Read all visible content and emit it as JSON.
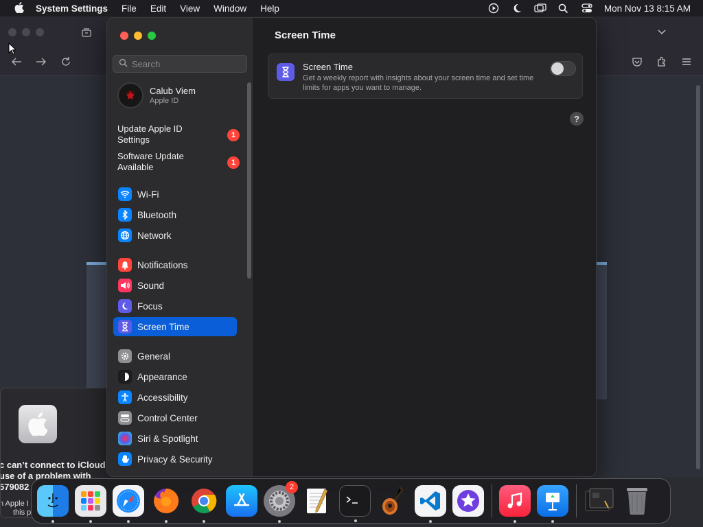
{
  "menubar": {
    "app_name": "System Settings",
    "menus": [
      "File",
      "Edit",
      "View",
      "Window",
      "Help"
    ],
    "clock": "Mon Nov 13  8:15 AM"
  },
  "icloud_dialog": {
    "message_lines": [
      "c can’t connect to iCloud",
      "use of a problem with",
      "579082"
    ],
    "sub_lines": [
      "n Apple I",
      "this p"
    ]
  },
  "settings": {
    "search_placeholder": "Search",
    "account": {
      "name": "Calub Viem",
      "subtitle": "Apple ID"
    },
    "notices": [
      {
        "label": "Update Apple ID Settings",
        "badge": "1"
      },
      {
        "label": "Software Update Available",
        "badge": "1"
      }
    ],
    "nav_items": [
      {
        "label": "Wi-Fi",
        "icon": "wifi-icon",
        "color": "#0a84ff"
      },
      {
        "label": "Bluetooth",
        "icon": "bluetooth-icon",
        "color": "#0a84ff"
      },
      {
        "label": "Network",
        "icon": "globe-icon",
        "color": "#0a84ff"
      },
      {
        "label": "Notifications",
        "icon": "bell-icon",
        "color": "#ff453a"
      },
      {
        "label": "Sound",
        "icon": "speaker-icon",
        "color": "#ff375f"
      },
      {
        "label": "Focus",
        "icon": "moon-icon",
        "color": "#5e5ce6"
      },
      {
        "label": "Screen Time",
        "icon": "hourglass-icon",
        "color": "#5e5ce6",
        "selected": true
      },
      {
        "label": "General",
        "icon": "gear-icon",
        "color": "#8e8e93"
      },
      {
        "label": "Appearance",
        "icon": "appearance-icon",
        "color": "#1c1c1e"
      },
      {
        "label": "Accessibility",
        "icon": "accessibility-icon",
        "color": "#0a84ff"
      },
      {
        "label": "Control Center",
        "icon": "control-center-icon",
        "color": "#8e8e93"
      },
      {
        "label": "Siri & Spotlight",
        "icon": "siri-icon",
        "color": "#2c2c2e"
      },
      {
        "label": "Privacy & Security",
        "icon": "hand-icon",
        "color": "#0a84ff"
      }
    ],
    "main": {
      "title": "Screen Time",
      "card": {
        "heading": "Screen Time",
        "description": "Get a weekly report with insights about your screen time and set time limits for apps you want to manage.",
        "toggle_on": false
      },
      "help": "?"
    }
  },
  "dock": {
    "apps": [
      {
        "name": "Finder",
        "icon": "finder-icon",
        "running": true
      },
      {
        "name": "Launchpad",
        "icon": "launchpad-icon",
        "running": true
      },
      {
        "name": "Safari",
        "icon": "safari-icon",
        "running": true
      },
      {
        "name": "Firefox",
        "icon": "firefox-icon",
        "running": true
      },
      {
        "name": "Chrome",
        "icon": "chrome-icon",
        "running": true
      },
      {
        "name": "App Store",
        "icon": "app-store-icon",
        "running": false
      },
      {
        "name": "System Settings",
        "icon": "system-settings-icon",
        "running": true,
        "badge": "2"
      },
      {
        "name": "TextEdit",
        "icon": "textedit-icon",
        "running": false
      },
      {
        "name": "Terminal",
        "icon": "terminal-icon",
        "running": true
      },
      {
        "name": "GarageBand",
        "icon": "garageband-icon",
        "running": false
      },
      {
        "name": "Visual Studio Code",
        "icon": "vscode-icon",
        "running": true
      },
      {
        "name": "iMovie",
        "icon": "imovie-icon",
        "running": false
      },
      {
        "name": "Music",
        "icon": "music-icon",
        "running": true
      },
      {
        "name": "Keynote",
        "icon": "keynote-icon",
        "running": true
      },
      {
        "name": "Downloads",
        "icon": "downloads-stack-icon",
        "running": false
      },
      {
        "name": "Trash",
        "icon": "trash-icon",
        "running": false
      }
    ]
  }
}
